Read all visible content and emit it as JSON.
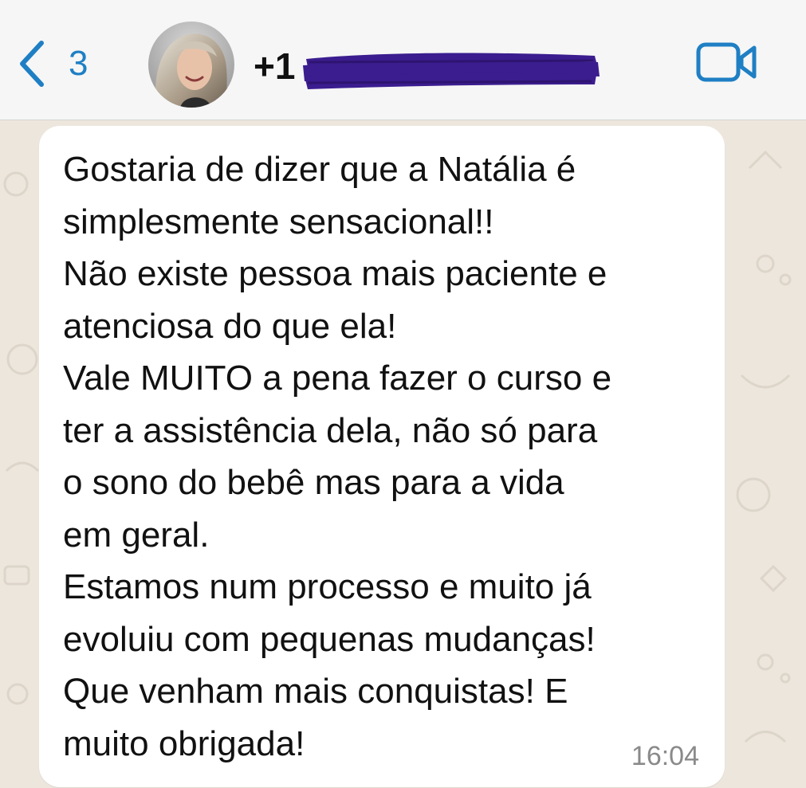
{
  "header": {
    "back_count": "3",
    "contact_name_visible": "+1",
    "icons": {
      "back": "chevron-left-icon",
      "video": "video-camera-icon"
    },
    "accent_color": "#1f7fc4",
    "redaction_color": "#3b1d8f"
  },
  "message": {
    "text": "Gostaria de dizer que a Natália é\nsimplesmente sensacional!!\nNão existe pessoa mais paciente e\natenciosa do que ela!\nVale MUITO a pena fazer o curso e\nter a assistência dela, não só para\no sono do bebê mas para a vida\nem geral.\nEstamos num processo e muito já\nevoluiu com pequenas mudanças!\nQue venham mais conquistas! E\nmuito obrigada!",
    "time": "16:04"
  }
}
